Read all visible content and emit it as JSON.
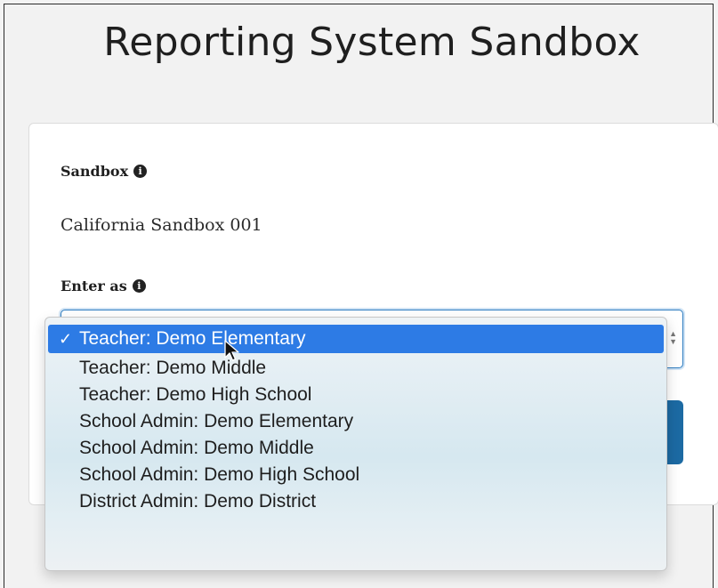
{
  "page": {
    "title": "Reporting System Sandbox"
  },
  "form": {
    "sandbox_label": "Sandbox",
    "sandbox_value": "California Sandbox 001",
    "enter_as_label": "Enter as",
    "info_glyph": "i"
  },
  "dropdown": {
    "check_glyph": "✓",
    "selected_index": 0,
    "options": [
      "Teacher: Demo Elementary",
      "Teacher: Demo Middle",
      "Teacher: Demo High School",
      "School Admin: Demo Elementary",
      "School Admin: Demo Middle",
      "School Admin: Demo High School",
      "District Admin: Demo District"
    ]
  },
  "colors": {
    "selected_bg": "#2d7be5",
    "button_bg": "#1c6aa3",
    "focus_border": "#2f7dc0"
  },
  "icons": {
    "info": "info-circle-icon",
    "check": "checkmark-icon",
    "cursor": "mouse-pointer-icon",
    "select_arrows": "select-arrows-icon"
  }
}
